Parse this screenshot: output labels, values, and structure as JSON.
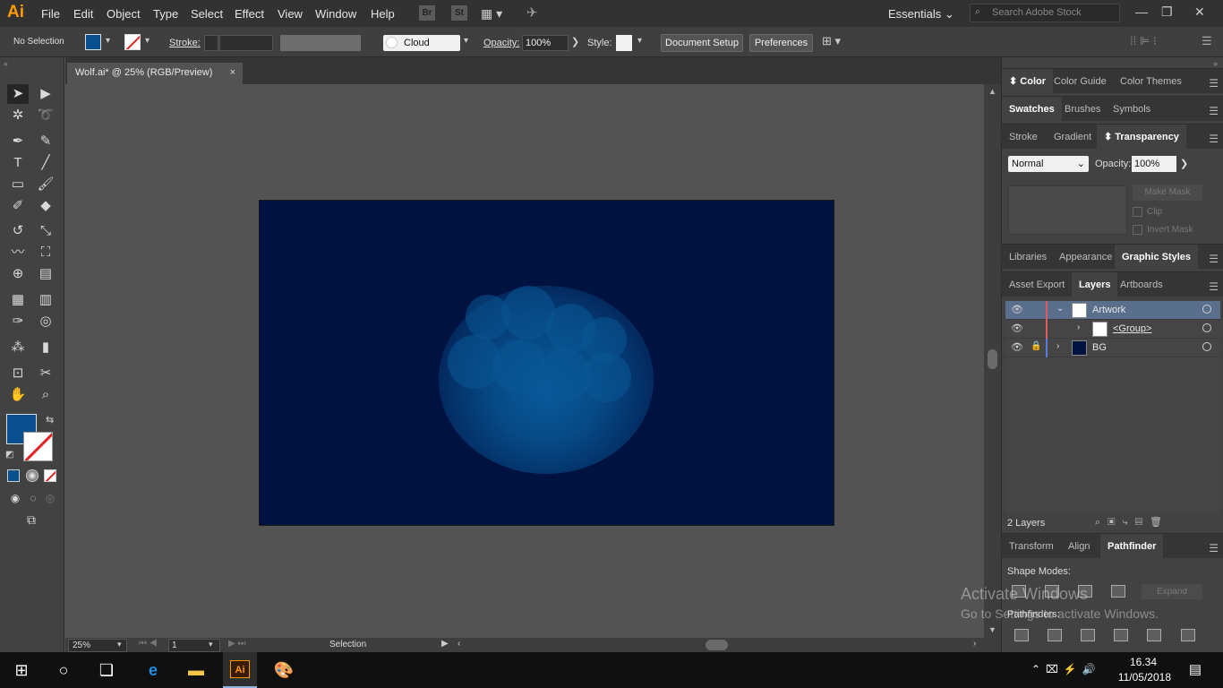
{
  "menubar": {
    "logo": "Ai",
    "items": [
      "File",
      "Edit",
      "Object",
      "Type",
      "Select",
      "Effect",
      "View",
      "Window",
      "Help"
    ],
    "bridge_label": "Br",
    "stock_label": "St",
    "workspace": "Essentials",
    "search_placeholder": "Search Adobe Stock"
  },
  "controlbar": {
    "selection": "No Selection",
    "stroke_label": "Stroke:",
    "brush_name": "Cloud",
    "opacity_label": "Opacity:",
    "opacity_value": "100%",
    "style_label": "Style:",
    "doc_setup": "Document Setup",
    "preferences": "Preferences",
    "fill_color": "#0a4f8e"
  },
  "document": {
    "tab_title": "Wolf.ai* @ 25% (RGB/Preview)",
    "close": "×",
    "artboard_color": "#001240"
  },
  "statusbar": {
    "zoom": "25%",
    "artboard": "1",
    "tool_status": "Selection"
  },
  "panels": {
    "group1": [
      "Color",
      "Color Guide",
      "Color Themes"
    ],
    "group2": [
      "Swatches",
      "Brushes",
      "Symbols"
    ],
    "group3": [
      "Stroke",
      "Gradient",
      "Transparency"
    ],
    "transparency": {
      "blend_mode": "Normal",
      "opacity_label": "Opacity:",
      "opacity_value": "100%",
      "make_mask": "Make Mask",
      "clip": "Clip",
      "invert_mask": "Invert Mask"
    },
    "group4": [
      "Libraries",
      "Appearance",
      "Graphic Styles"
    ],
    "group5": [
      "Asset Export",
      "Layers",
      "Artboards"
    ],
    "layers": [
      {
        "name": "Artwork",
        "color": "#e25a5a"
      },
      {
        "name": "<Group>",
        "color": "#e25a5a"
      },
      {
        "name": "BG",
        "color": "#5a7ae2"
      }
    ],
    "layers_count": "2 Layers",
    "group6": [
      "Transform",
      "Align",
      "Pathfinder"
    ],
    "pathfinder": {
      "shape_modes": "Shape Modes:",
      "expand": "Expand",
      "pathfinders": "Pathfinders:"
    }
  },
  "watermark": {
    "line1": "Activate Windows",
    "line2": "Go to Settings to activate Windows."
  },
  "taskbar": {
    "time": "16.34",
    "date": "11/05/2018"
  }
}
